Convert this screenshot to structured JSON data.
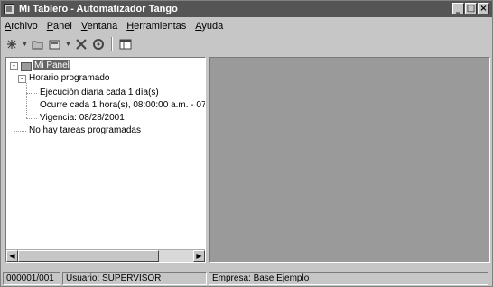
{
  "window": {
    "title": "Mi Tablero - Automatizador Tango",
    "minimize": "_",
    "maximize": "□",
    "close": "×"
  },
  "menu": {
    "items": [
      "Archivo",
      "Panel",
      "Ventana",
      "Herramientas",
      "Ayuda"
    ]
  },
  "toolbar": {
    "icons": [
      "new-item-icon",
      "dropdown-arrow",
      "open-icon",
      "new-panel-icon",
      "dropdown-arrow",
      "delete-icon",
      "properties-icon",
      "window-icon"
    ]
  },
  "tree": {
    "root": "Mi Panel",
    "schedule": "Horario programado",
    "schedule_items": [
      "Ejecución diaria cada 1 día(s)",
      "Ocurre cada 1 hora(s), 08:00:00 a.m. - 07:",
      "Vigencia: 08/28/2001"
    ],
    "no_tasks": "No hay tareas programadas"
  },
  "status": {
    "code": "000001/001",
    "user": "Usuario: SUPERVISOR",
    "company": "Empresa: Base Ejemplo"
  }
}
